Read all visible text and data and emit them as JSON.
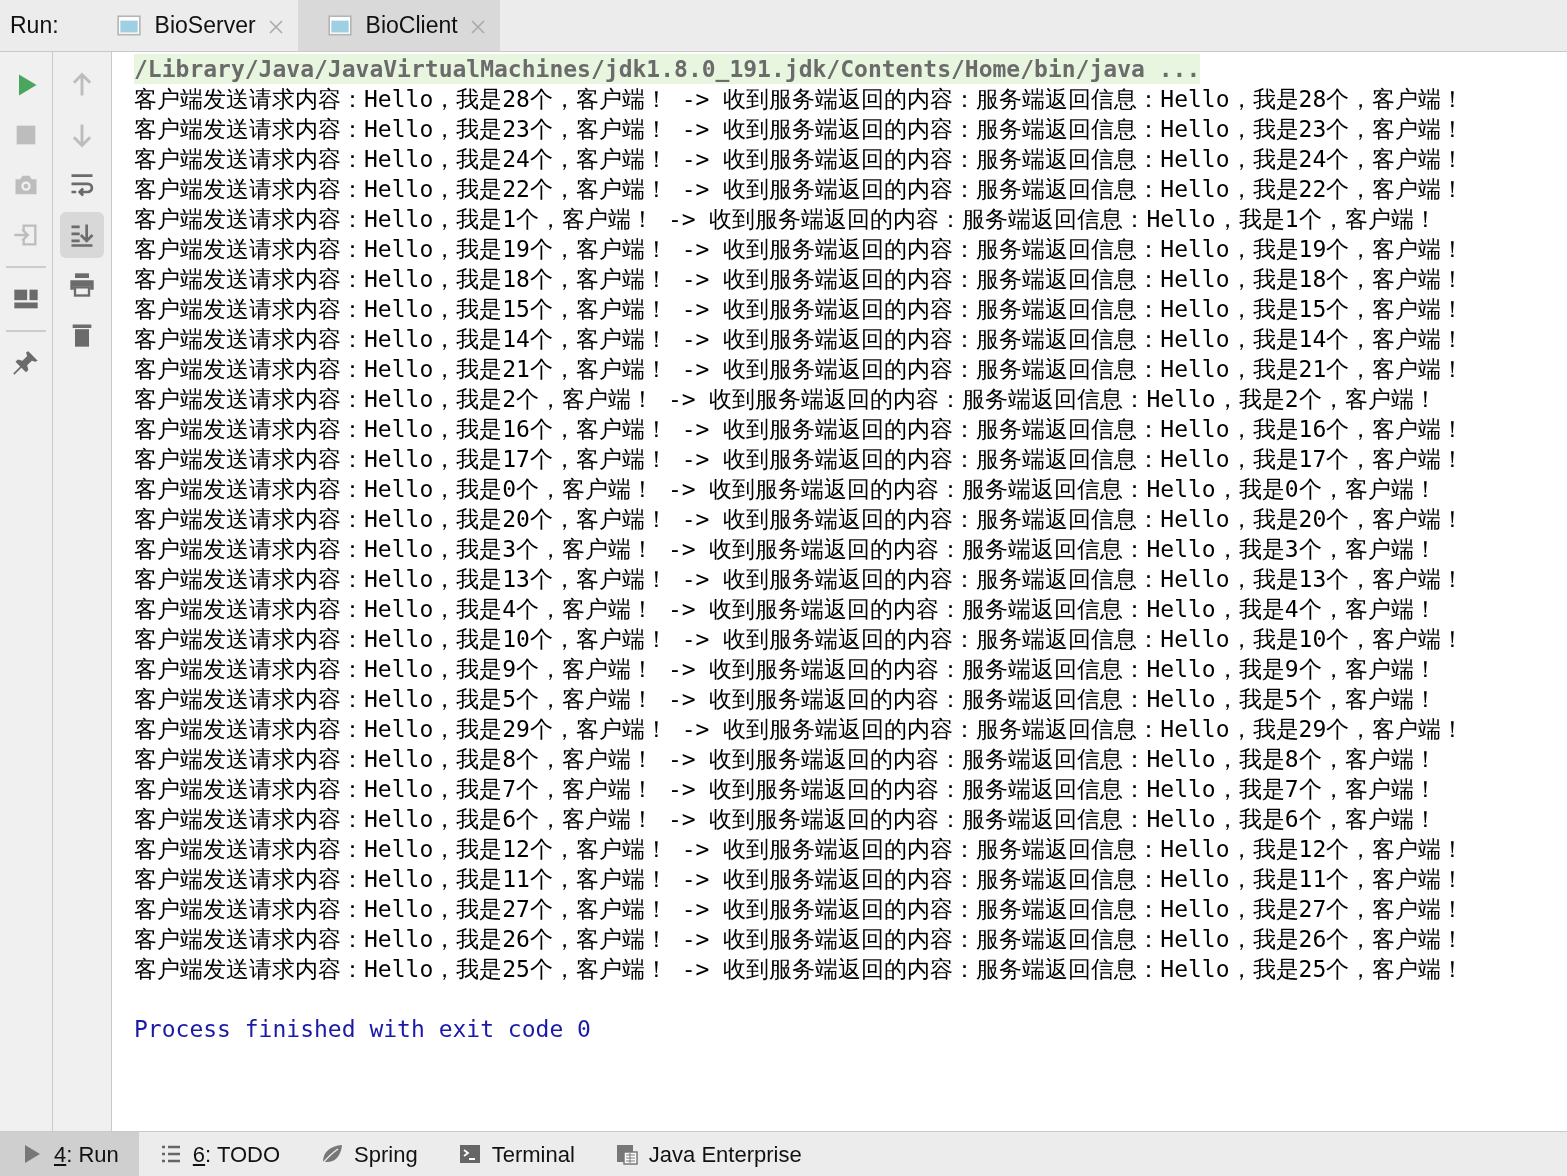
{
  "run_bar": {
    "label": "Run:",
    "tabs": [
      {
        "label": "BioServer",
        "selected": false
      },
      {
        "label": "BioClient",
        "selected": true
      }
    ]
  },
  "toolbar_left": [
    {
      "kind": "run",
      "disabled": false,
      "on": false
    },
    {
      "kind": "stop",
      "disabled": true,
      "on": false
    },
    {
      "kind": "camera",
      "disabled": true,
      "on": false
    },
    {
      "kind": "enter",
      "disabled": true,
      "on": false
    },
    {
      "kind": "separator"
    },
    {
      "kind": "layout",
      "disabled": false,
      "on": false
    },
    {
      "kind": "separator"
    },
    {
      "kind": "pin",
      "disabled": false,
      "on": false
    }
  ],
  "toolbar_right": [
    {
      "kind": "up",
      "disabled": true,
      "on": false
    },
    {
      "kind": "down",
      "disabled": true,
      "on": false
    },
    {
      "kind": "wrap",
      "disabled": false,
      "on": false
    },
    {
      "kind": "scroll-end",
      "disabled": false,
      "on": true
    },
    {
      "kind": "print",
      "disabled": false,
      "on": false
    },
    {
      "kind": "trash",
      "disabled": false,
      "on": false
    }
  ],
  "console": {
    "command": "/Library/Java/JavaVirtualMachines/jdk1.8.0_191.jdk/Contents/Home/bin/java ...",
    "lines": [
      "客户端发送请求内容：Hello，我是28个，客户端！ -> 收到服务端返回的内容：服务端返回信息：Hello，我是28个，客户端！",
      "客户端发送请求内容：Hello，我是23个，客户端！ -> 收到服务端返回的内容：服务端返回信息：Hello，我是23个，客户端！",
      "客户端发送请求内容：Hello，我是24个，客户端！ -> 收到服务端返回的内容：服务端返回信息：Hello，我是24个，客户端！",
      "客户端发送请求内容：Hello，我是22个，客户端！ -> 收到服务端返回的内容：服务端返回信息：Hello，我是22个，客户端！",
      "客户端发送请求内容：Hello，我是1个，客户端！ -> 收到服务端返回的内容：服务端返回信息：Hello，我是1个，客户端！",
      "客户端发送请求内容：Hello，我是19个，客户端！ -> 收到服务端返回的内容：服务端返回信息：Hello，我是19个，客户端！",
      "客户端发送请求内容：Hello，我是18个，客户端！ -> 收到服务端返回的内容：服务端返回信息：Hello，我是18个，客户端！",
      "客户端发送请求内容：Hello，我是15个，客户端！ -> 收到服务端返回的内容：服务端返回信息：Hello，我是15个，客户端！",
      "客户端发送请求内容：Hello，我是14个，客户端！ -> 收到服务端返回的内容：服务端返回信息：Hello，我是14个，客户端！",
      "客户端发送请求内容：Hello，我是21个，客户端！ -> 收到服务端返回的内容：服务端返回信息：Hello，我是21个，客户端！",
      "客户端发送请求内容：Hello，我是2个，客户端！ -> 收到服务端返回的内容：服务端返回信息：Hello，我是2个，客户端！",
      "客户端发送请求内容：Hello，我是16个，客户端！ -> 收到服务端返回的内容：服务端返回信息：Hello，我是16个，客户端！",
      "客户端发送请求内容：Hello，我是17个，客户端！ -> 收到服务端返回的内容：服务端返回信息：Hello，我是17个，客户端！",
      "客户端发送请求内容：Hello，我是0个，客户端！ -> 收到服务端返回的内容：服务端返回信息：Hello，我是0个，客户端！",
      "客户端发送请求内容：Hello，我是20个，客户端！ -> 收到服务端返回的内容：服务端返回信息：Hello，我是20个，客户端！",
      "客户端发送请求内容：Hello，我是3个，客户端！ -> 收到服务端返回的内容：服务端返回信息：Hello，我是3个，客户端！",
      "客户端发送请求内容：Hello，我是13个，客户端！ -> 收到服务端返回的内容：服务端返回信息：Hello，我是13个，客户端！",
      "客户端发送请求内容：Hello，我是4个，客户端！ -> 收到服务端返回的内容：服务端返回信息：Hello，我是4个，客户端！",
      "客户端发送请求内容：Hello，我是10个，客户端！ -> 收到服务端返回的内容：服务端返回信息：Hello，我是10个，客户端！",
      "客户端发送请求内容：Hello，我是9个，客户端！ -> 收到服务端返回的内容：服务端返回信息：Hello，我是9个，客户端！",
      "客户端发送请求内容：Hello，我是5个，客户端！ -> 收到服务端返回的内容：服务端返回信息：Hello，我是5个，客户端！",
      "客户端发送请求内容：Hello，我是29个，客户端！ -> 收到服务端返回的内容：服务端返回信息：Hello，我是29个，客户端！",
      "客户端发送请求内容：Hello，我是8个，客户端！ -> 收到服务端返回的内容：服务端返回信息：Hello，我是8个，客户端！",
      "客户端发送请求内容：Hello，我是7个，客户端！ -> 收到服务端返回的内容：服务端返回信息：Hello，我是7个，客户端！",
      "客户端发送请求内容：Hello，我是6个，客户端！ -> 收到服务端返回的内容：服务端返回信息：Hello，我是6个，客户端！",
      "客户端发送请求内容：Hello，我是12个，客户端！ -> 收到服务端返回的内容：服务端返回信息：Hello，我是12个，客户端！",
      "客户端发送请求内容：Hello，我是11个，客户端！ -> 收到服务端返回的内容：服务端返回信息：Hello，我是11个，客户端！",
      "客户端发送请求内容：Hello，我是27个，客户端！ -> 收到服务端返回的内容：服务端返回信息：Hello，我是27个，客户端！",
      "客户端发送请求内容：Hello，我是26个，客户端！ -> 收到服务端返回的内容：服务端返回信息：Hello，我是26个，客户端！",
      "客户端发送请求内容：Hello，我是25个，客户端！ -> 收到服务端返回的内容：服务端返回信息：Hello，我是25个，客户端！"
    ],
    "exit_message": "Process finished with exit code 0"
  },
  "bottom_tools": [
    {
      "kind": "run",
      "label": "4: Run",
      "mnemonic": true,
      "selected": true
    },
    {
      "kind": "todo",
      "label": "6: TODO",
      "mnemonic": true,
      "selected": false
    },
    {
      "kind": "spring",
      "label": "Spring",
      "mnemonic": false,
      "selected": false
    },
    {
      "kind": "terminal",
      "label": "Terminal",
      "mnemonic": false,
      "selected": false
    },
    {
      "kind": "javaee",
      "label": "Java Enterprise",
      "mnemonic": false,
      "selected": false
    }
  ]
}
